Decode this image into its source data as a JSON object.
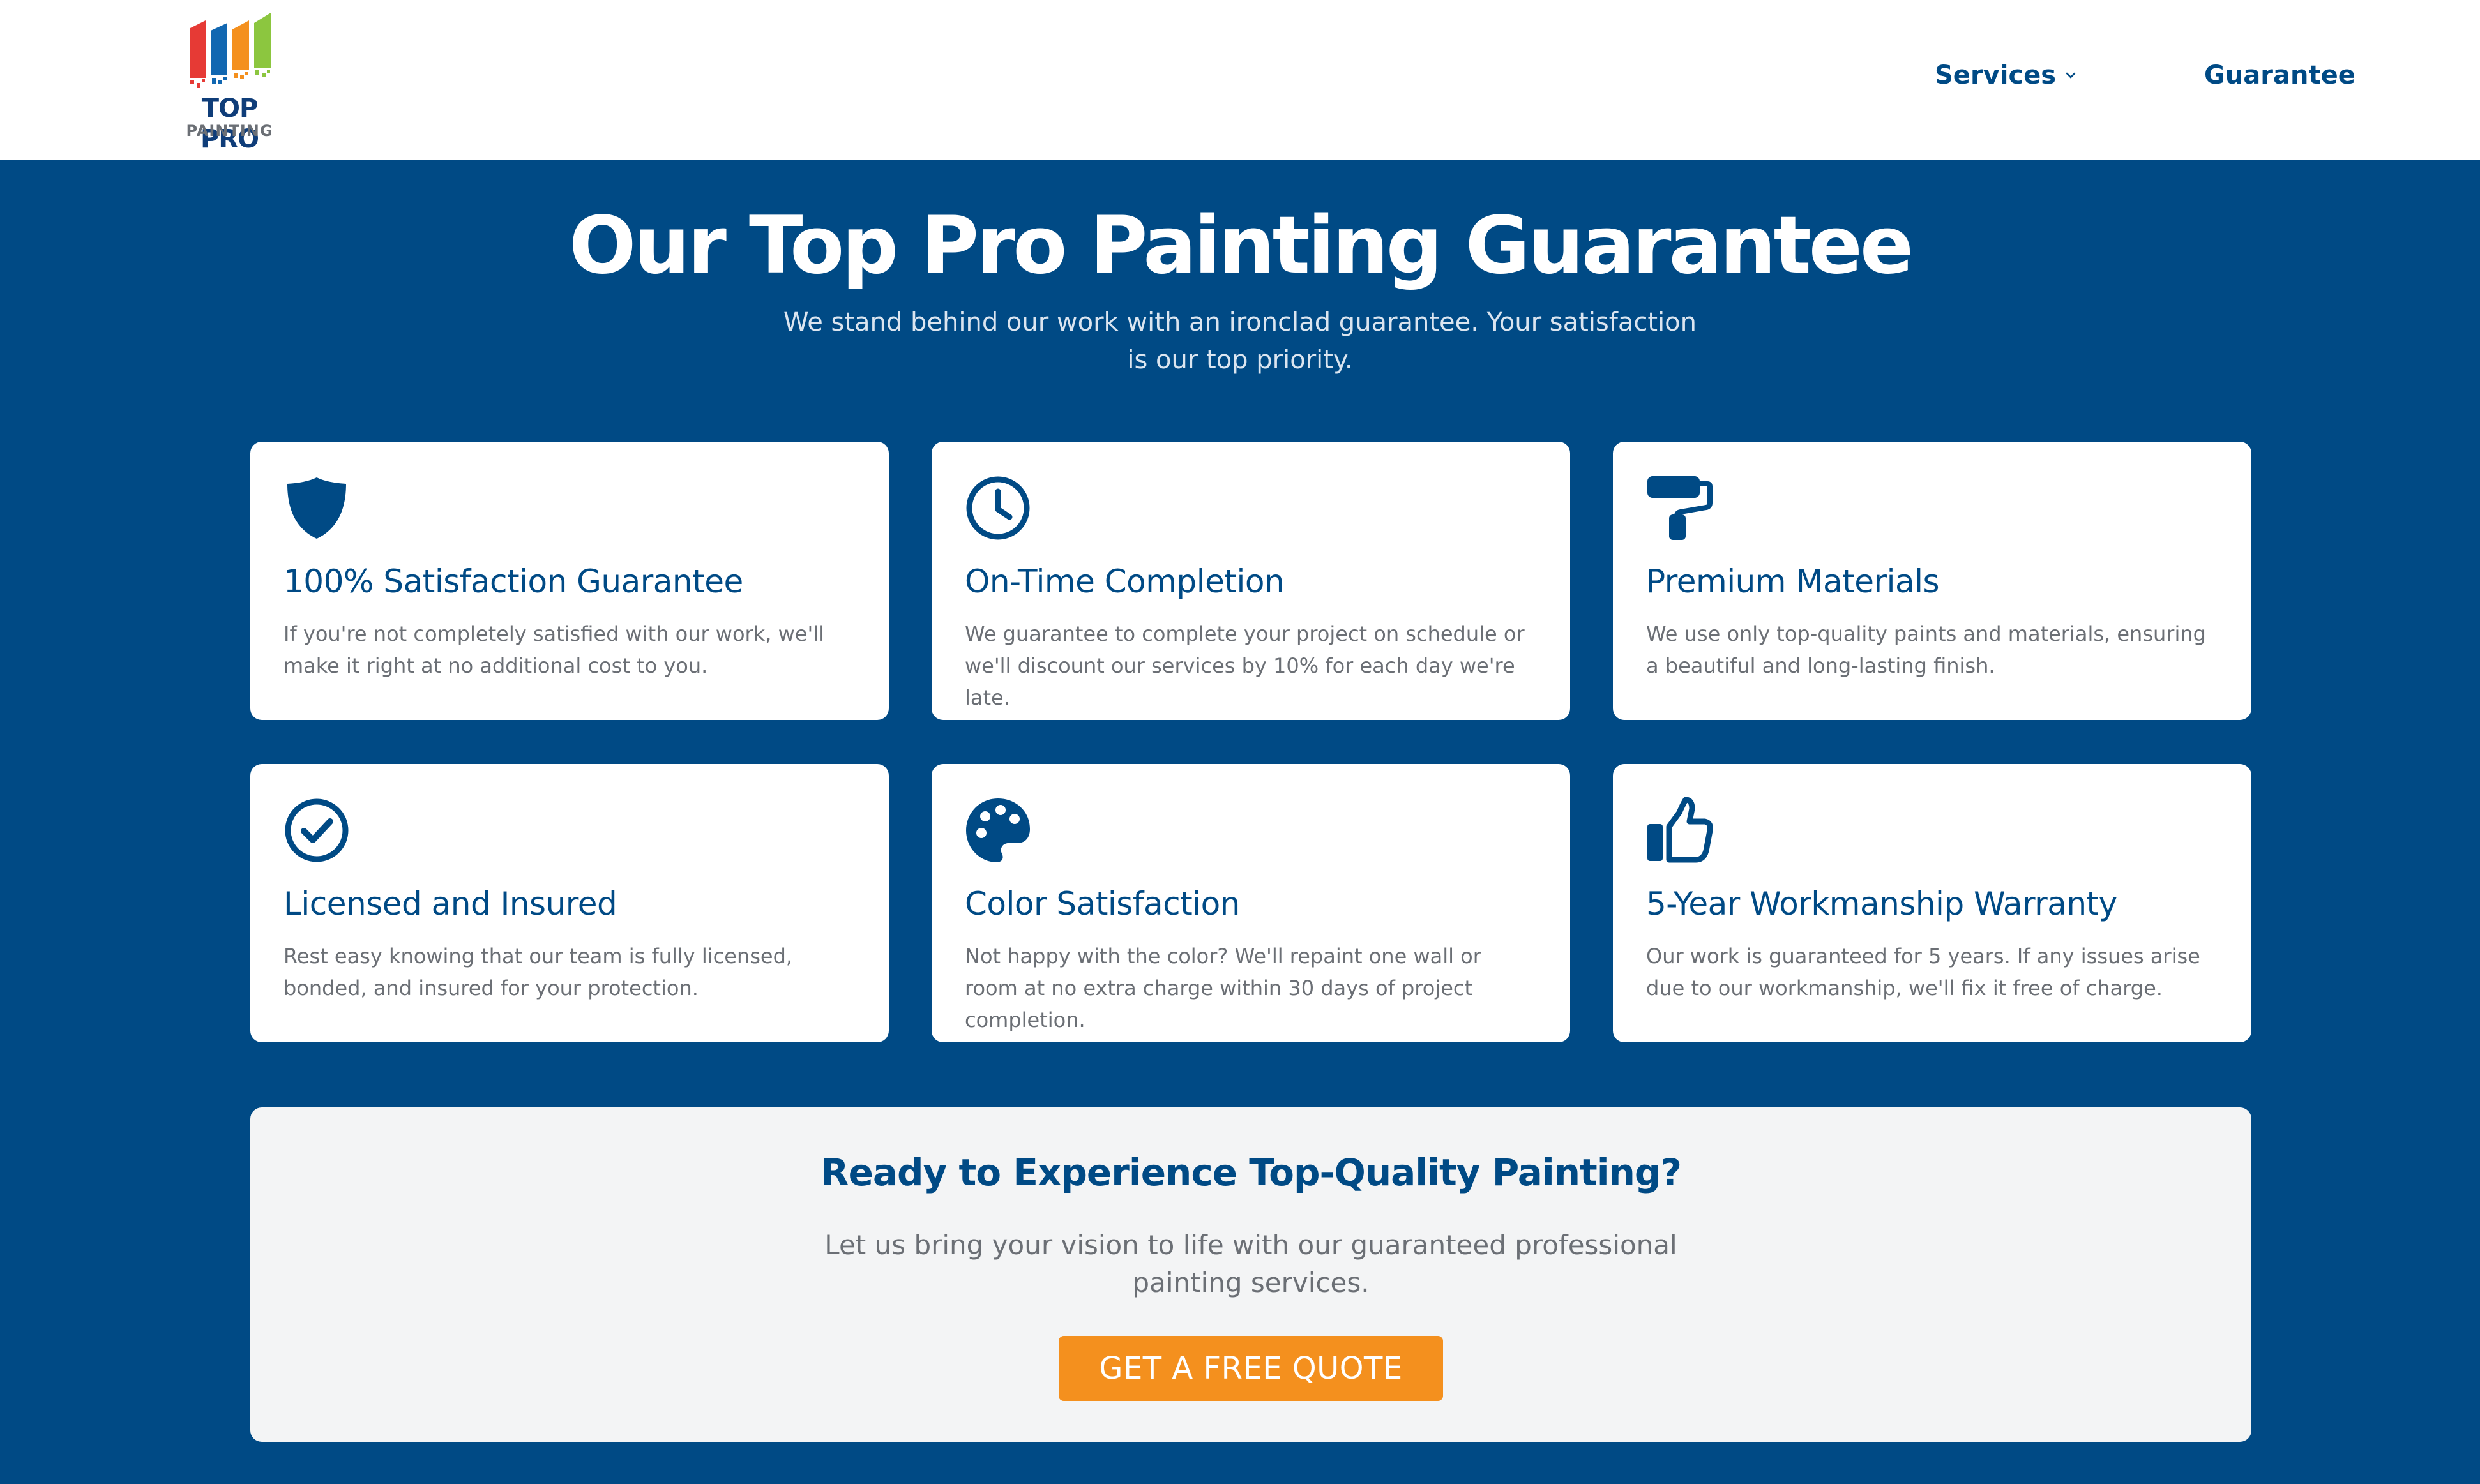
{
  "brand": {
    "name_line1": "TOP PRO",
    "name_line2": "PAINTING",
    "colors": {
      "bar_red": "#e63a35",
      "bar_blue": "#1167b1",
      "bar_orange": "#f4901e",
      "bar_green": "#8cc63f"
    }
  },
  "nav": {
    "items": [
      {
        "label": "Services",
        "has_dropdown": true,
        "icon": "chevron-down-icon"
      },
      {
        "label": "Guarantee",
        "has_dropdown": false
      }
    ]
  },
  "hero": {
    "title": "Our Top Pro Painting Guarantee",
    "subtitle": "We stand behind our work with an ironclad guarantee. Your satisfaction is our top priority."
  },
  "cards": [
    {
      "icon": "shield-icon",
      "title": "100% Satisfaction Guarantee",
      "description": "If you're not completely satisfied with our work, we'll make it right at no additional cost to you."
    },
    {
      "icon": "clock-icon",
      "title": "On-Time Completion",
      "description": "We guarantee to complete your project on schedule or we'll discount our services by 10% for each day we're late."
    },
    {
      "icon": "paint-roller-icon",
      "title": "Premium Materials",
      "description": "We use only top-quality paints and materials, ensuring a beautiful and long-lasting finish."
    },
    {
      "icon": "check-circle-icon",
      "title": "Licensed and Insured",
      "description": "Rest easy knowing that our team is fully licensed, bonded, and insured for your protection."
    },
    {
      "icon": "palette-icon",
      "title": "Color Satisfaction",
      "description": "Not happy with the color? We'll repaint one wall or room at no extra charge within 30 days of project completion."
    },
    {
      "icon": "thumbs-up-icon",
      "title": "5-Year Workmanship Warranty",
      "description": "Our work is guaranteed for 5 years. If any issues arise due to our workmanship, we'll fix it free of charge."
    }
  ],
  "cta": {
    "title": "Ready to Experience Top-Quality Painting?",
    "text": "Let us bring your vision to life with our guaranteed professional painting services.",
    "button_label": "GET A FREE QUOTE"
  },
  "theme": {
    "primary": "#004a85",
    "accent": "#f4901e",
    "text_muted": "#6b6f75",
    "card_bg": "#ffffff",
    "cta_bg": "#f3f4f5"
  }
}
